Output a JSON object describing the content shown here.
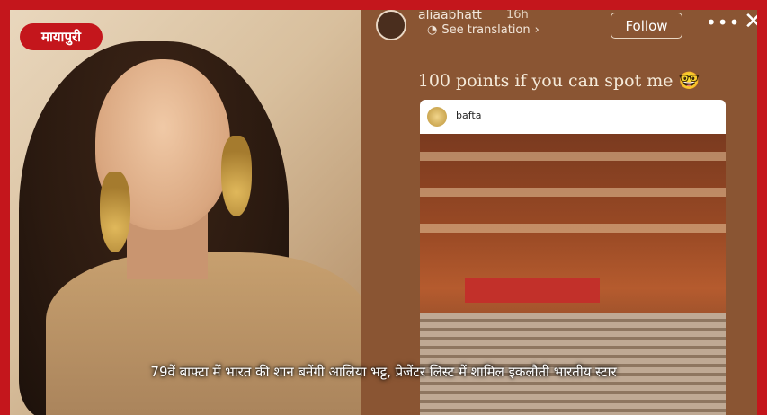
{
  "logo": {
    "text": "मायापुरी"
  },
  "story": {
    "username": "aliaabhatt",
    "time": "16h",
    "see_translation": "See translation",
    "follow_label": "Follow",
    "more_icon": "more-dots-icon",
    "close_icon": "close-icon",
    "caption": "100 points if you can spot me 🤓",
    "post": {
      "username": "bafta"
    }
  },
  "headline": "79वें बाफ्टा में भारत की शान बनेंगी आलिया भट्ट, प्रेजेंटर लिस्ट में शामिल इकलौती भारतीय स्टार",
  "colors": {
    "frame": "#c4161c",
    "story_bg": "#8a5533"
  }
}
